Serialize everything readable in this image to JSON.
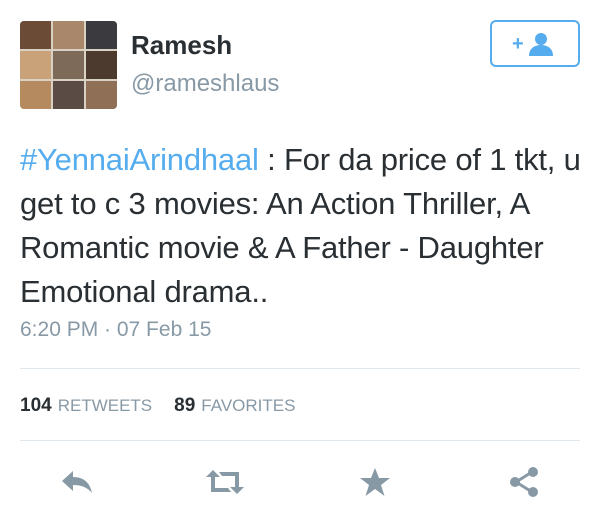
{
  "user": {
    "name": "Ramesh",
    "handle": "@rameshlaus",
    "avatar_icon": "avatar-collage"
  },
  "follow_button": {
    "icon": "add-user-icon",
    "label": "+"
  },
  "tweet": {
    "hashtag": "#YennaiArindhaal",
    "body": " : For da price of 1 tkt, u get to c 3 movies: An Action Thriller, A Romantic movie & A Father - Daughter Emotional drama.."
  },
  "timestamp": "6:20 PM · 07 Feb 15",
  "stats": {
    "retweets_count": "104",
    "retweets_label": "RETWEETS",
    "favorites_count": "89",
    "favorites_label": "FAVORITES"
  },
  "actions": {
    "reply_icon": "reply-icon",
    "retweet_icon": "retweet-icon",
    "favorite_icon": "star-icon",
    "share_icon": "share-icon"
  },
  "colors": {
    "accent": "#55acee",
    "text": "#292f33",
    "muted": "#8899a6",
    "icon": "#8899a6",
    "divider": "#e1e8ed"
  }
}
